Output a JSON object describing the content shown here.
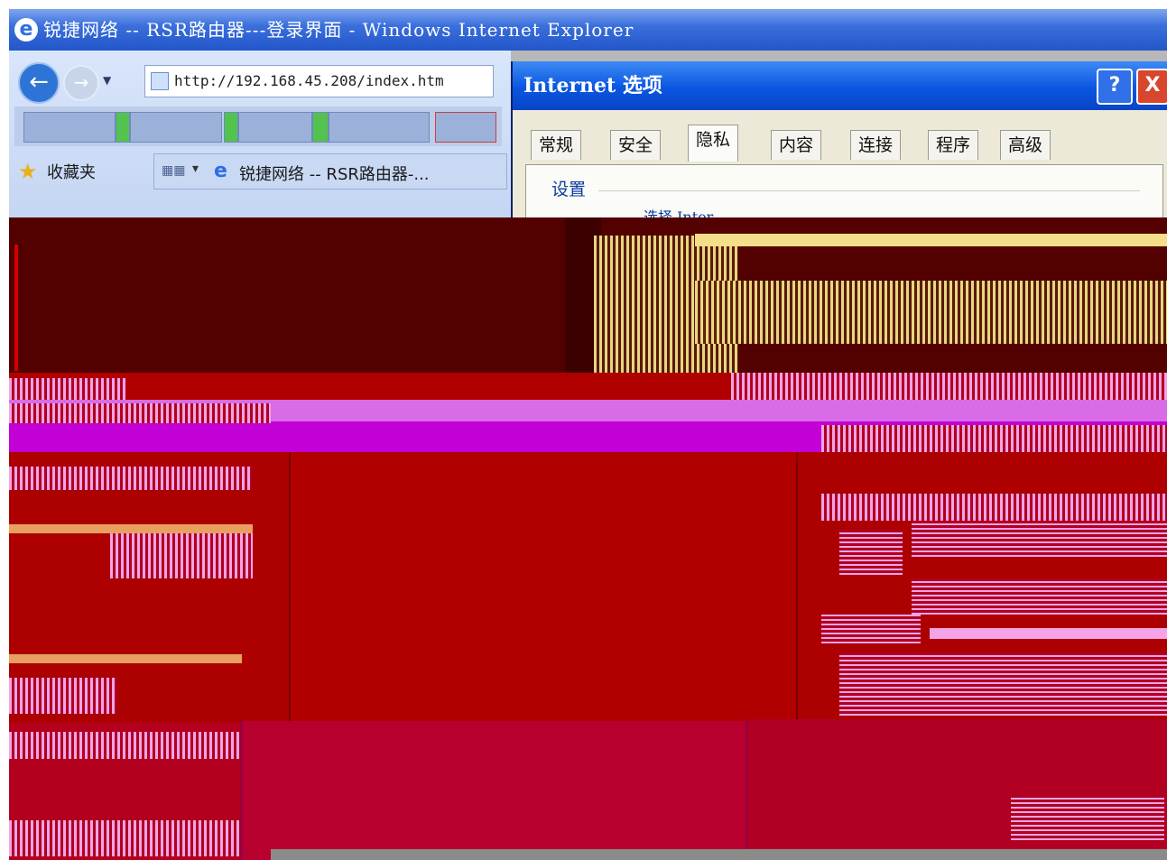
{
  "window": {
    "title": "锐捷网络 -- RSR路由器---登录界面 - Windows Internet Explorer"
  },
  "browser": {
    "address_url": "http://192.168.45.208/index.htm",
    "favorites_label": "收藏夹",
    "tab_title": "锐捷网络 -- RSR路由器-..."
  },
  "dialog": {
    "title": "Internet 选项",
    "help_label": "?",
    "close_label": "X",
    "tabs": [
      {
        "label": "常规",
        "active": false
      },
      {
        "label": "安全",
        "active": false
      },
      {
        "label": "隐私",
        "active": true
      },
      {
        "label": "内容",
        "active": false
      },
      {
        "label": "连接",
        "active": false
      },
      {
        "label": "程序",
        "active": false
      },
      {
        "label": "高级",
        "active": false
      }
    ],
    "section_heading": "设置",
    "hint_text": "选择 Inter"
  },
  "colors": {
    "xp_blue": "#0a56e0",
    "corruption_red": "#ae0202",
    "corruption_magenta": "#c300d6"
  }
}
